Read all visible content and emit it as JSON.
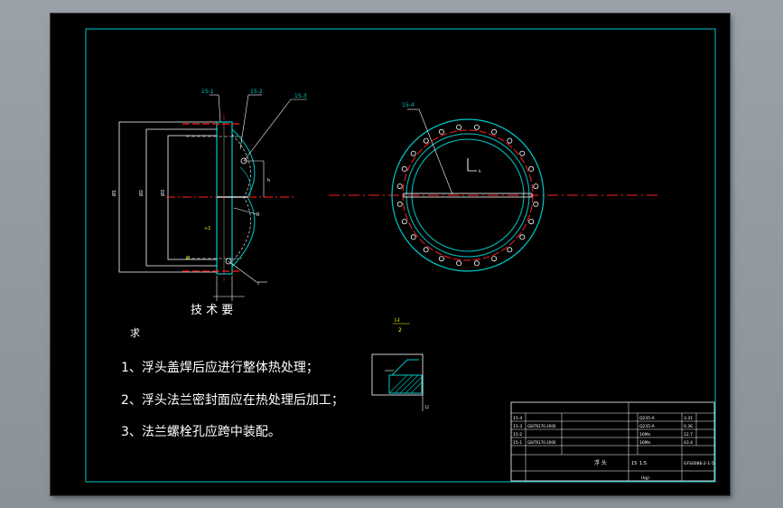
{
  "colors": {
    "background": "#000000",
    "border": "#00c8c8",
    "centerline": "#ff2020",
    "text": "#ffffff",
    "leader": "#ffffff",
    "dimension": "#00c8c8",
    "yellow": "#ffff00",
    "page": "#8e959d"
  },
  "drawing": {
    "callouts": {
      "part_15_1": "15-1",
      "part_15_2": "15-2",
      "part_15_3": "15-3",
      "part_15_4": "15-4"
    },
    "section_mark_top": "I-I",
    "section_mark_bottom": "2",
    "tech_title": "技 术 要",
    "tech_title_extra": "求",
    "tech_notes": [
      "1、浮头盖焊后应进行整体热处理；",
      "2、浮头法兰密封面应在热处理后加工；",
      "3、法兰螺栓孔应跨中装配。"
    ]
  },
  "title_block": {
    "rows": [
      {
        "no": "15-4",
        "code": "",
        "name": "",
        "qty": "",
        "material": "Q235-A",
        "weight": "3.31"
      },
      {
        "no": "15-3",
        "code": "GB/T6170-2000",
        "name": "",
        "qty": "",
        "material": "Q235-A",
        "weight": "0.36"
      },
      {
        "no": "15-2",
        "code": "",
        "name": "",
        "qty": "",
        "material": "16Mn",
        "weight": "12.7"
      },
      {
        "no": "15-1",
        "code": "GB/T6170-2000",
        "name": "",
        "qty": "",
        "material": "16Mn",
        "weight": "43.4"
      }
    ],
    "name": "浮 头",
    "scale": "1:5",
    "sheet_no": "15",
    "drawing_no": "GFS0086-2-1-5",
    "total_weight": "(kg)"
  }
}
